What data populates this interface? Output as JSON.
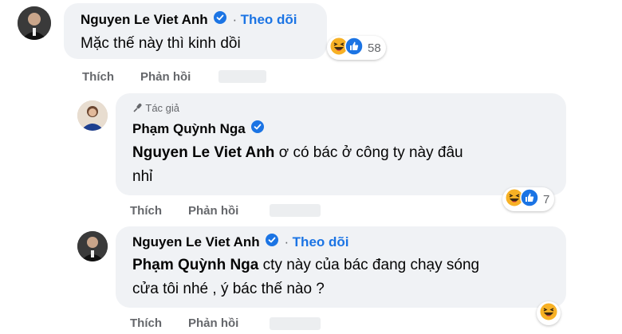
{
  "comments": [
    {
      "author": "Nguyen Le Viet Anh",
      "follow_label": "Theo dõi",
      "text": "Mặc thế này thì kinh dồi",
      "reaction_count": "58",
      "actions": {
        "like": "Thích",
        "reply": "Phản hồi"
      }
    },
    {
      "badge": "Tác giả",
      "author": "Phạm Quỳnh Nga",
      "mention": "Nguyen Le Viet Anh",
      "text_line1": " ơ có bác ở công ty này đâu",
      "text_line2": "nhỉ",
      "reaction_count": "7",
      "actions": {
        "like": "Thích",
        "reply": "Phản hồi"
      }
    },
    {
      "author": "Nguyen Le Viet Anh",
      "follow_label": "Theo dõi",
      "mention": "Phạm Quỳnh Nga",
      "text_line1": " cty này của bác đang chạy sóng",
      "text_line2": "cửa tôi nhé , ý bác thế nào ?",
      "actions": {
        "like": "Thích",
        "reply": "Phản hồi"
      }
    }
  ],
  "colors": {
    "link": "#1b74e4",
    "bubble": "#f0f2f5",
    "meta": "#65676b"
  }
}
